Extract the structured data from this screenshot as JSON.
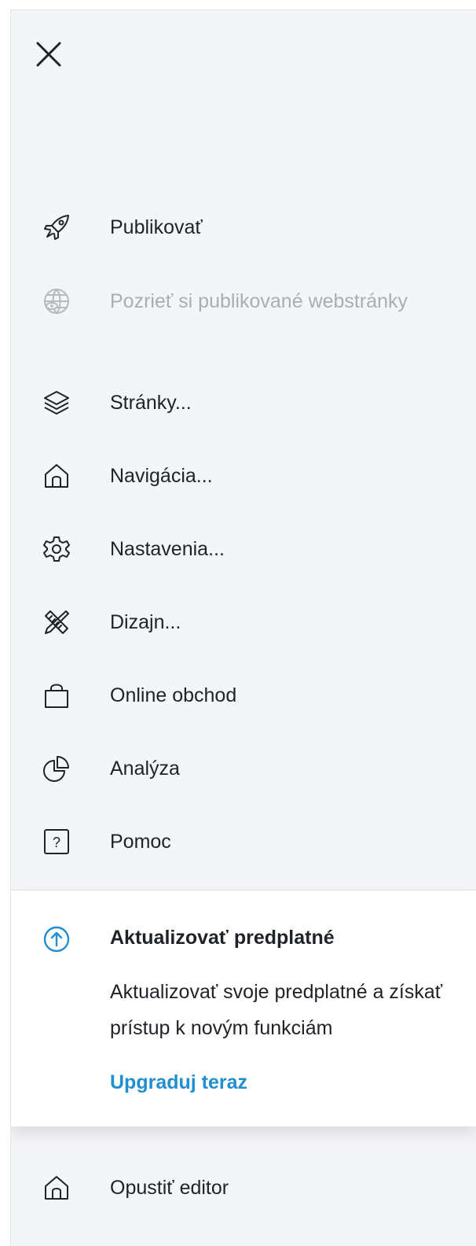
{
  "colors": {
    "panel_bg": "#f4f5f7",
    "text": "#1f2229",
    "disabled_text": "#a9adb5",
    "accent": "#1f8fd1"
  },
  "menu": {
    "close_icon": "close-icon",
    "items": [
      {
        "label": "Publikovať",
        "icon": "rocket-icon",
        "disabled": false
      },
      {
        "label": "Pozrieť si publikované webstránky",
        "icon": "globe-eye-icon",
        "disabled": true
      },
      {
        "label": "Stránky...",
        "icon": "layers-icon",
        "disabled": false
      },
      {
        "label": "Navigácia...",
        "icon": "home-icon",
        "disabled": false
      },
      {
        "label": "Nastavenia...",
        "icon": "gear-icon",
        "disabled": false
      },
      {
        "label": "Dizajn...",
        "icon": "ruler-pencil-icon",
        "disabled": false
      },
      {
        "label": "Online obchod",
        "icon": "shopping-bag-icon",
        "disabled": false
      },
      {
        "label": "Analýza",
        "icon": "pie-chart-icon",
        "disabled": false
      },
      {
        "label": "Pomoc",
        "icon": "help-box-icon",
        "disabled": false
      }
    ]
  },
  "upgrade": {
    "icon": "arrow-up-circle-icon",
    "title": "Aktualizovať predplatné",
    "description": "Aktualizovať svoje predplatné a získať prístup k novým funkciám",
    "link": "Upgraduj teraz"
  },
  "exit": {
    "label": "Opustiť editor",
    "icon": "home-icon"
  }
}
